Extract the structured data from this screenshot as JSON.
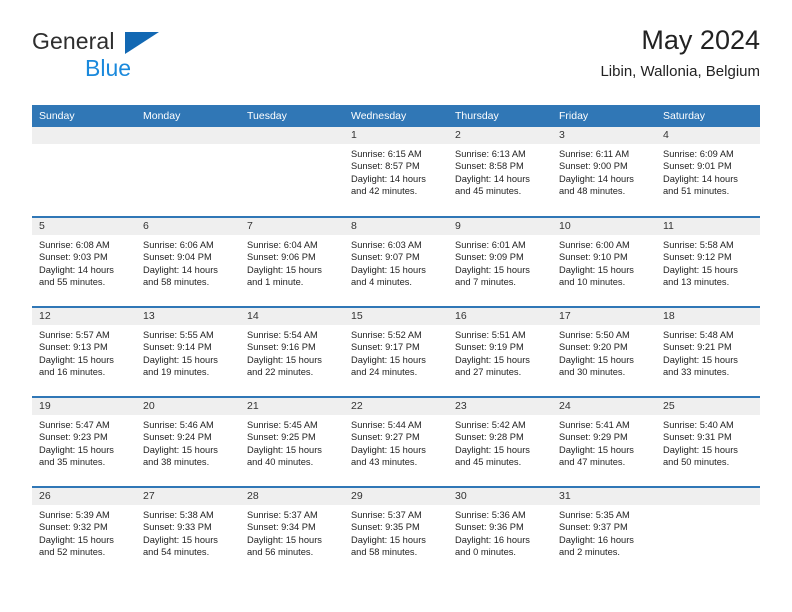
{
  "brand": {
    "name_top": "General",
    "name_bottom": "Blue",
    "accent_color": "#1268b3",
    "blue_text_color": "#1a89dc"
  },
  "header": {
    "title": "May 2024",
    "subtitle": "Libin, Wallonia, Belgium"
  },
  "theme": {
    "header_row_bg": "#3077b6",
    "daynum_band_bg": "#efefef",
    "cell_bg": "#ffffff",
    "row_divider": "#3077b6"
  },
  "weekday_headers": [
    "Sunday",
    "Monday",
    "Tuesday",
    "Wednesday",
    "Thursday",
    "Friday",
    "Saturday"
  ],
  "weeks": [
    [
      {
        "day": "",
        "sunrise": "",
        "sunset": "",
        "daylight_l1": "",
        "daylight_l2": "",
        "empty": true
      },
      {
        "day": "",
        "sunrise": "",
        "sunset": "",
        "daylight_l1": "",
        "daylight_l2": "",
        "empty": true
      },
      {
        "day": "",
        "sunrise": "",
        "sunset": "",
        "daylight_l1": "",
        "daylight_l2": "",
        "empty": true
      },
      {
        "day": "1",
        "sunrise": "Sunrise: 6:15 AM",
        "sunset": "Sunset: 8:57 PM",
        "daylight_l1": "Daylight: 14 hours",
        "daylight_l2": "and 42 minutes."
      },
      {
        "day": "2",
        "sunrise": "Sunrise: 6:13 AM",
        "sunset": "Sunset: 8:58 PM",
        "daylight_l1": "Daylight: 14 hours",
        "daylight_l2": "and 45 minutes."
      },
      {
        "day": "3",
        "sunrise": "Sunrise: 6:11 AM",
        "sunset": "Sunset: 9:00 PM",
        "daylight_l1": "Daylight: 14 hours",
        "daylight_l2": "and 48 minutes."
      },
      {
        "day": "4",
        "sunrise": "Sunrise: 6:09 AM",
        "sunset": "Sunset: 9:01 PM",
        "daylight_l1": "Daylight: 14 hours",
        "daylight_l2": "and 51 minutes."
      }
    ],
    [
      {
        "day": "5",
        "sunrise": "Sunrise: 6:08 AM",
        "sunset": "Sunset: 9:03 PM",
        "daylight_l1": "Daylight: 14 hours",
        "daylight_l2": "and 55 minutes."
      },
      {
        "day": "6",
        "sunrise": "Sunrise: 6:06 AM",
        "sunset": "Sunset: 9:04 PM",
        "daylight_l1": "Daylight: 14 hours",
        "daylight_l2": "and 58 minutes."
      },
      {
        "day": "7",
        "sunrise": "Sunrise: 6:04 AM",
        "sunset": "Sunset: 9:06 PM",
        "daylight_l1": "Daylight: 15 hours",
        "daylight_l2": "and 1 minute."
      },
      {
        "day": "8",
        "sunrise": "Sunrise: 6:03 AM",
        "sunset": "Sunset: 9:07 PM",
        "daylight_l1": "Daylight: 15 hours",
        "daylight_l2": "and 4 minutes."
      },
      {
        "day": "9",
        "sunrise": "Sunrise: 6:01 AM",
        "sunset": "Sunset: 9:09 PM",
        "daylight_l1": "Daylight: 15 hours",
        "daylight_l2": "and 7 minutes."
      },
      {
        "day": "10",
        "sunrise": "Sunrise: 6:00 AM",
        "sunset": "Sunset: 9:10 PM",
        "daylight_l1": "Daylight: 15 hours",
        "daylight_l2": "and 10 minutes."
      },
      {
        "day": "11",
        "sunrise": "Sunrise: 5:58 AM",
        "sunset": "Sunset: 9:12 PM",
        "daylight_l1": "Daylight: 15 hours",
        "daylight_l2": "and 13 minutes."
      }
    ],
    [
      {
        "day": "12",
        "sunrise": "Sunrise: 5:57 AM",
        "sunset": "Sunset: 9:13 PM",
        "daylight_l1": "Daylight: 15 hours",
        "daylight_l2": "and 16 minutes."
      },
      {
        "day": "13",
        "sunrise": "Sunrise: 5:55 AM",
        "sunset": "Sunset: 9:14 PM",
        "daylight_l1": "Daylight: 15 hours",
        "daylight_l2": "and 19 minutes."
      },
      {
        "day": "14",
        "sunrise": "Sunrise: 5:54 AM",
        "sunset": "Sunset: 9:16 PM",
        "daylight_l1": "Daylight: 15 hours",
        "daylight_l2": "and 22 minutes."
      },
      {
        "day": "15",
        "sunrise": "Sunrise: 5:52 AM",
        "sunset": "Sunset: 9:17 PM",
        "daylight_l1": "Daylight: 15 hours",
        "daylight_l2": "and 24 minutes."
      },
      {
        "day": "16",
        "sunrise": "Sunrise: 5:51 AM",
        "sunset": "Sunset: 9:19 PM",
        "daylight_l1": "Daylight: 15 hours",
        "daylight_l2": "and 27 minutes."
      },
      {
        "day": "17",
        "sunrise": "Sunrise: 5:50 AM",
        "sunset": "Sunset: 9:20 PM",
        "daylight_l1": "Daylight: 15 hours",
        "daylight_l2": "and 30 minutes."
      },
      {
        "day": "18",
        "sunrise": "Sunrise: 5:48 AM",
        "sunset": "Sunset: 9:21 PM",
        "daylight_l1": "Daylight: 15 hours",
        "daylight_l2": "and 33 minutes."
      }
    ],
    [
      {
        "day": "19",
        "sunrise": "Sunrise: 5:47 AM",
        "sunset": "Sunset: 9:23 PM",
        "daylight_l1": "Daylight: 15 hours",
        "daylight_l2": "and 35 minutes."
      },
      {
        "day": "20",
        "sunrise": "Sunrise: 5:46 AM",
        "sunset": "Sunset: 9:24 PM",
        "daylight_l1": "Daylight: 15 hours",
        "daylight_l2": "and 38 minutes."
      },
      {
        "day": "21",
        "sunrise": "Sunrise: 5:45 AM",
        "sunset": "Sunset: 9:25 PM",
        "daylight_l1": "Daylight: 15 hours",
        "daylight_l2": "and 40 minutes."
      },
      {
        "day": "22",
        "sunrise": "Sunrise: 5:44 AM",
        "sunset": "Sunset: 9:27 PM",
        "daylight_l1": "Daylight: 15 hours",
        "daylight_l2": "and 43 minutes."
      },
      {
        "day": "23",
        "sunrise": "Sunrise: 5:42 AM",
        "sunset": "Sunset: 9:28 PM",
        "daylight_l1": "Daylight: 15 hours",
        "daylight_l2": "and 45 minutes."
      },
      {
        "day": "24",
        "sunrise": "Sunrise: 5:41 AM",
        "sunset": "Sunset: 9:29 PM",
        "daylight_l1": "Daylight: 15 hours",
        "daylight_l2": "and 47 minutes."
      },
      {
        "day": "25",
        "sunrise": "Sunrise: 5:40 AM",
        "sunset": "Sunset: 9:31 PM",
        "daylight_l1": "Daylight: 15 hours",
        "daylight_l2": "and 50 minutes."
      }
    ],
    [
      {
        "day": "26",
        "sunrise": "Sunrise: 5:39 AM",
        "sunset": "Sunset: 9:32 PM",
        "daylight_l1": "Daylight: 15 hours",
        "daylight_l2": "and 52 minutes."
      },
      {
        "day": "27",
        "sunrise": "Sunrise: 5:38 AM",
        "sunset": "Sunset: 9:33 PM",
        "daylight_l1": "Daylight: 15 hours",
        "daylight_l2": "and 54 minutes."
      },
      {
        "day": "28",
        "sunrise": "Sunrise: 5:37 AM",
        "sunset": "Sunset: 9:34 PM",
        "daylight_l1": "Daylight: 15 hours",
        "daylight_l2": "and 56 minutes."
      },
      {
        "day": "29",
        "sunrise": "Sunrise: 5:37 AM",
        "sunset": "Sunset: 9:35 PM",
        "daylight_l1": "Daylight: 15 hours",
        "daylight_l2": "and 58 minutes."
      },
      {
        "day": "30",
        "sunrise": "Sunrise: 5:36 AM",
        "sunset": "Sunset: 9:36 PM",
        "daylight_l1": "Daylight: 16 hours",
        "daylight_l2": "and 0 minutes."
      },
      {
        "day": "31",
        "sunrise": "Sunrise: 5:35 AM",
        "sunset": "Sunset: 9:37 PM",
        "daylight_l1": "Daylight: 16 hours",
        "daylight_l2": "and 2 minutes."
      },
      {
        "day": "",
        "sunrise": "",
        "sunset": "",
        "daylight_l1": "",
        "daylight_l2": "",
        "empty": true
      }
    ]
  ]
}
